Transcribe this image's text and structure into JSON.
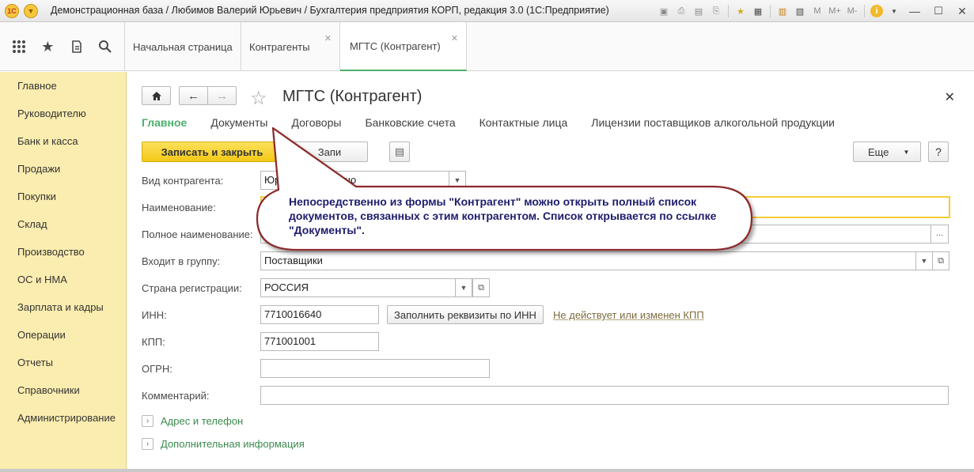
{
  "window": {
    "title": "Демонстрационная база / Любимов Валерий Юрьевич / Бухгалтерия предприятия КОРП, редакция 3.0  (1С:Предприятие)",
    "logo_text": "1С",
    "toolbar_letters": [
      "M",
      "M+",
      "M-"
    ]
  },
  "tabs": [
    {
      "label": "Начальная страница",
      "closable": false
    },
    {
      "label": "Контрагенты",
      "closable": true
    },
    {
      "label": "МГТС (Контрагент)",
      "closable": true,
      "active": true
    }
  ],
  "sections": [
    "Главное",
    "Руководителю",
    "Банк и касса",
    "Продажи",
    "Покупки",
    "Склад",
    "Производство",
    "ОС и НМА",
    "Зарплата и кадры",
    "Операции",
    "Отчеты",
    "Справочники",
    "Администрирование"
  ],
  "form": {
    "title": "МГТС (Контрагент)",
    "nav": [
      "Главное",
      "Документы",
      "Договоры",
      "Банковские счета",
      "Контактные лица",
      "Лицензии поставщиков алкогольной продукции"
    ],
    "save_close_label": "Записать и закрыть",
    "save_label": "Запи",
    "more_label": "Еще",
    "help_label": "?",
    "fields": {
      "kind": {
        "label": "Вид контрагента:",
        "value": "Юридическое лицо"
      },
      "name": {
        "label": "Наименование:",
        "value": ""
      },
      "full_name": {
        "label": "Полное наименование:",
        "value": ""
      },
      "group": {
        "label": "Входит в группу:",
        "value": "Поставщики"
      },
      "country": {
        "label": "Страна регистрации:",
        "value": "РОССИЯ"
      },
      "inn": {
        "label": "ИНН:",
        "value": "7710016640"
      },
      "kpp": {
        "label": "КПП:",
        "value": "771001001"
      },
      "ogrn": {
        "label": "ОГРН:",
        "value": ""
      },
      "comment": {
        "label": "Комментарий:",
        "value": ""
      }
    },
    "fill_by_inn_label": "Заполнить реквизиты по ИНН",
    "kpp_changed_link": "Не действует или изменен КПП",
    "address_group": "Адрес и телефон",
    "extra_group": "Дополнительная информация"
  },
  "callout": {
    "text": "Непосредственно из формы \"Контрагент\" можно открыть полный список документов, связанных с этим контрагентом. Список открывается по ссылке \"Документы\"."
  },
  "colors": {
    "accent_green": "#4db06b",
    "sections_bg": "#fbedaf",
    "primary_button": "#f5d432",
    "callout_border": "#8b2a2a"
  }
}
